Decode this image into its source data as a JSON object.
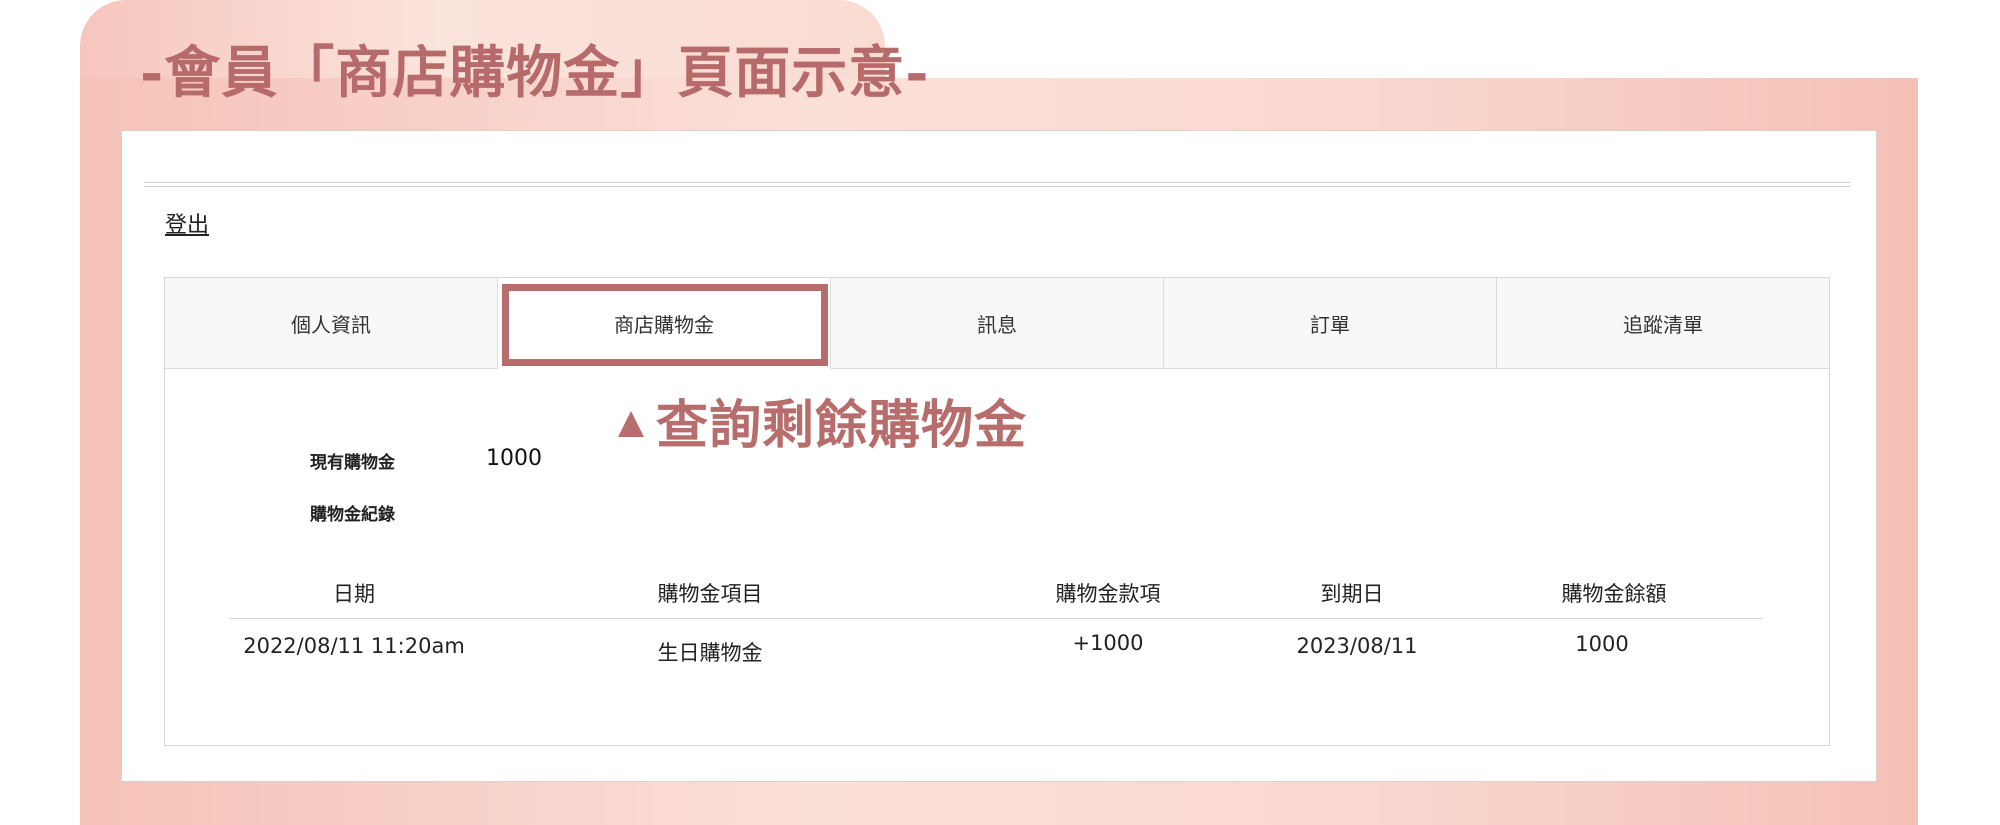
{
  "frame": {
    "title": "-會員「商店購物金」頁面示意-",
    "annotation": "查詢剩餘購物金",
    "accent_color": "#b86d6d"
  },
  "header": {
    "logout_label": "登出"
  },
  "tabs": [
    {
      "label": "個人資訊",
      "active": false
    },
    {
      "label": "商店購物金",
      "active": true
    },
    {
      "label": "訊息",
      "active": false
    },
    {
      "label": "訂單",
      "active": false
    },
    {
      "label": "追蹤清單",
      "active": false
    }
  ],
  "credit": {
    "current_label": "現有購物金",
    "current_value": "1000",
    "history_label": "購物金紀錄"
  },
  "table": {
    "columns": [
      "日期",
      "購物金項目",
      "購物金款項",
      "到期日",
      "購物金餘額"
    ],
    "rows": [
      [
        "2022/08/11 11:20am",
        "生日購物金",
        "+1000",
        "2023/08/11",
        "1000"
      ]
    ]
  }
}
